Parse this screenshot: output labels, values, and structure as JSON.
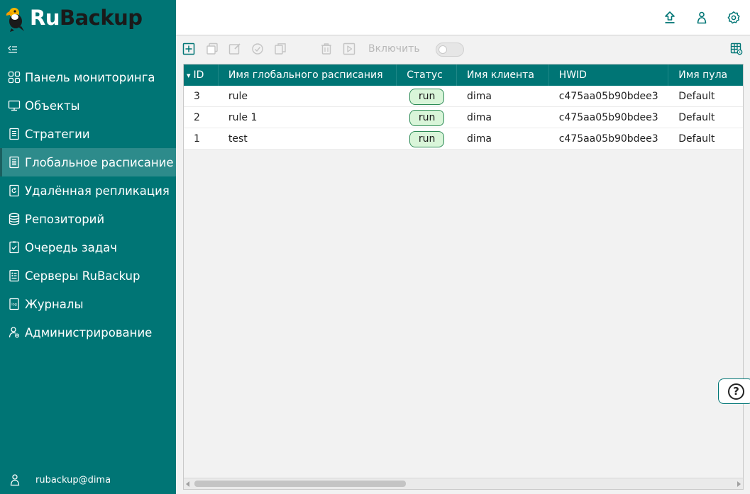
{
  "app": {
    "logo_ru": "Ru",
    "logo_backup": "Backup"
  },
  "sidebar": {
    "items": [
      {
        "label": "Панель мониторинга",
        "icon": "dashboard-icon"
      },
      {
        "label": "Объекты",
        "icon": "monitor-icon"
      },
      {
        "label": "Стратегии",
        "icon": "document-icon"
      },
      {
        "label": "Глобальное расписание",
        "icon": "schedule-icon",
        "active": true
      },
      {
        "label": "Удалённая репликация",
        "icon": "replication-icon"
      },
      {
        "label": "Репозиторий",
        "icon": "database-icon"
      },
      {
        "label": "Очередь задач",
        "icon": "task-queue-icon"
      },
      {
        "label": "Серверы RuBackup",
        "icon": "server-icon"
      },
      {
        "label": "Журналы",
        "icon": "log-icon"
      },
      {
        "label": "Администрирование",
        "icon": "admin-user-icon"
      }
    ],
    "user": "rubackup@dima"
  },
  "toolbar": {
    "enable_label": "Включить",
    "enable_toggle": false
  },
  "table": {
    "columns": [
      "ID",
      "Имя глобального расписания",
      "Статус",
      "Имя клиента",
      "HWID",
      "Имя пула"
    ],
    "sort_indicator": "▾",
    "rows": [
      {
        "id": "3",
        "name": "rule",
        "status": "run",
        "client": "dima",
        "hwid": "c475aa05b90bdee3",
        "pool": "Default"
      },
      {
        "id": "2",
        "name": "rule 1",
        "status": "run",
        "client": "dima",
        "hwid": "c475aa05b90bdee3",
        "pool": "Default"
      },
      {
        "id": "1",
        "name": "test",
        "status": "run",
        "client": "dima",
        "hwid": "c475aa05b90bdee3",
        "pool": "Default"
      }
    ]
  },
  "help": {
    "label": "?"
  },
  "colors": {
    "sidebar": "#007575",
    "active_item": "#2d8b8b",
    "badge_bg": "#d9f5d9",
    "badge_border": "#2e8b57"
  }
}
